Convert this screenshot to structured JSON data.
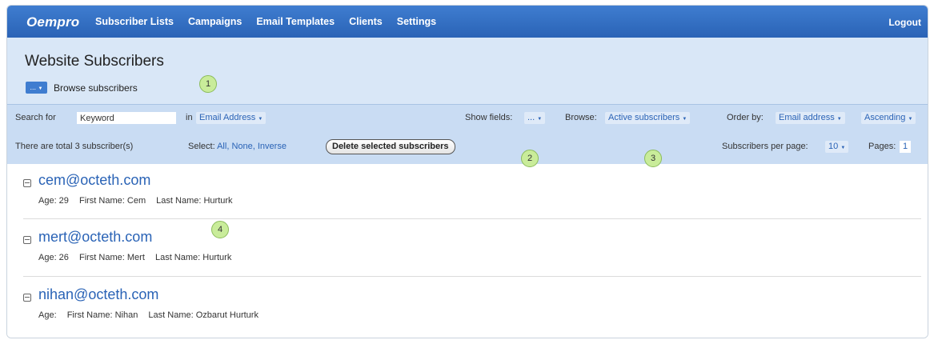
{
  "app": {
    "logo": "Oempro",
    "logout": "Logout"
  },
  "nav": [
    "Subscriber Lists",
    "Campaigns",
    "Email Templates",
    "Clients",
    "Settings"
  ],
  "header": {
    "title": "Website Subscribers",
    "browse_dropdown": "...",
    "browse_label": "Browse subscribers"
  },
  "toolbar": {
    "search_for": "Search for",
    "keyword_value": "Keyword",
    "in_label": "in",
    "field_select": "Email Address",
    "show_fields_label": "Show fields:",
    "show_fields_value": "...",
    "browse_label": "Browse:",
    "browse_value": "Active subscribers",
    "order_by_label": "Order by:",
    "order_by_value": "Email address",
    "order_dir_value": "Ascending",
    "total_text": "There are total 3 subscriber(s)",
    "select_label": "Select:",
    "select_all": "All,",
    "select_none": "None,",
    "select_inverse": "Inverse",
    "delete_button": "Delete selected subscribers",
    "per_page_label": "Subscribers per page:",
    "per_page_value": "10",
    "pages_label": "Pages:",
    "pages_value": "1"
  },
  "subscribers": [
    {
      "email": "cem@octeth.com",
      "age": "Age: 29",
      "first": "First Name: Cem",
      "last": "Last Name: Hurturk"
    },
    {
      "email": "mert@octeth.com",
      "age": "Age: 26",
      "first": "First Name: Mert",
      "last": "Last Name: Hurturk"
    },
    {
      "email": "nihan@octeth.com",
      "age": "Age:",
      "first": "First Name: Nihan",
      "last": "Last Name: Ozbarut Hurturk"
    }
  ],
  "callouts": [
    "1",
    "2",
    "3",
    "4"
  ],
  "colors": {
    "nav_bg": "#2a63b6",
    "header_bg": "#d9e7f7",
    "toolbar_bg": "#c9dcf3",
    "link": "#2a63b6",
    "callout": "#c9ec9a"
  }
}
